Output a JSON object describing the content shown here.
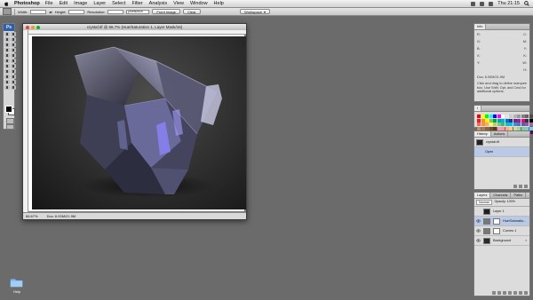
{
  "menubar": {
    "app_name": "Photoshop",
    "menus": [
      "File",
      "Edit",
      "Image",
      "Layer",
      "Select",
      "Filter",
      "Analysis",
      "View",
      "Window",
      "Help"
    ],
    "clock": "Thu 21:15"
  },
  "options_bar": {
    "width_label": "Width:",
    "height_label": "Height:",
    "resolution_label": "Resolution:",
    "units": "pixels/inch",
    "front_image": "Front Image",
    "clear": "Clear",
    "workspace": "Workspace"
  },
  "document": {
    "title": "crystal.tif @ 66.7% (Hue/Saturation 1, Layer Mask/16)",
    "zoom": "66.67%",
    "doc_size": "Doc: 6.00M/21.9M"
  },
  "info_panel": {
    "tabs": [
      "Info"
    ],
    "labels": [
      "R:",
      "G:",
      "B:",
      "C:",
      "M:",
      "Y:",
      "K:",
      "X:",
      "Y:",
      "W:",
      "H:"
    ],
    "doc_line": "Doc: 6.00M/21.9M",
    "help_text": "Click and drag to define marquee box. Use Shift, Opt, and Cmd for additional options."
  },
  "swatches": [
    "#ff0000",
    "#ffff00",
    "#00ff00",
    "#00ffff",
    "#0000ff",
    "#ff00ff",
    "#ffffff",
    "#e6e6e6",
    "#cccccc",
    "#b3b3b3",
    "#999999",
    "#808080",
    "#666666",
    "#4d4d4d",
    "#ed1c24",
    "#f7941d",
    "#fff200",
    "#8dc63f",
    "#00a651",
    "#00a99d",
    "#00aeef",
    "#0072bc",
    "#2e3192",
    "#662d91",
    "#92278f",
    "#ec008c",
    "#333333",
    "#000000",
    "#f26c4f",
    "#f68e56",
    "#fbaf5d",
    "#fff568",
    "#acd373",
    "#7cc576",
    "#3bb878",
    "#1abbb4",
    "#00bff3",
    "#438ccb",
    "#5574b9",
    "#605ca8",
    "#855fa8",
    "#a763a8",
    "#c4915b",
    "#a67c52",
    "#8c6239",
    "#754c24",
    "#603913",
    "#f49ac2",
    "#f6989d",
    "#f9ad81",
    "#fdc68a",
    "#c4df9b",
    "#a3d39c",
    "#82ca9c",
    "#7accc8",
    "#6dcff6",
    "#9e0b0f",
    "#a0410d",
    "#a36209",
    "#aba000",
    "#598527",
    "#1a7b30",
    "#007236",
    "#00746b",
    "#0076a3",
    "#004a80",
    "#003471",
    "#1b1464",
    "#440e62",
    "#630460"
  ],
  "history_panel": {
    "tabs": [
      "History",
      "Actions"
    ],
    "items": [
      "crystal.tif",
      "Open"
    ]
  },
  "layers_panel": {
    "tabs": [
      "Layers",
      "Channels",
      "Paths"
    ],
    "blend_mode": "Normal",
    "opacity_label": "Opacity: 100%",
    "layers": [
      "Layer 1",
      "Hue/Saturatio...",
      "Curves 1",
      "Background"
    ]
  },
  "desktop": {
    "folder_label": "Help"
  }
}
